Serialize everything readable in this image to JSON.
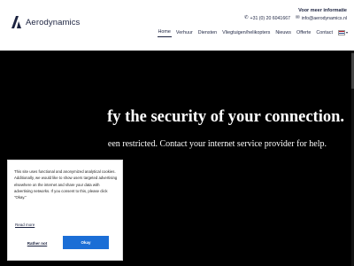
{
  "brand": {
    "name": "Aerodynamics"
  },
  "header": {
    "info_title": "Voor meer informatie",
    "phone": "+31 (0) 20 6041667",
    "email": "info@aerodynamics.nl"
  },
  "nav": {
    "items": [
      "Home",
      "Verhuur",
      "Diensten",
      "Vliegtuigen/helikopters",
      "Nieuws",
      "Offerte",
      "Contact"
    ],
    "active": "Home",
    "language_flag": "nl-flag-icon"
  },
  "hero": {
    "headline": "fy the security of your connection.",
    "subtext": "een restricted. Contact your internet service provider for help."
  },
  "cookie": {
    "text": "This site uses functional and anonymized analytical cookies. Additionally, we would like to show users targeted advertising elsewhere on the internet and share your data with advertising networks. If you consent to this, please click \"Okay.\"",
    "more_link": "Read more",
    "reject_label": "Rather not",
    "accept_label": "Okay"
  },
  "colors": {
    "brand_navy": "#1c2340",
    "accept_blue": "#1b6ed6",
    "hero_bg": "#000000"
  }
}
